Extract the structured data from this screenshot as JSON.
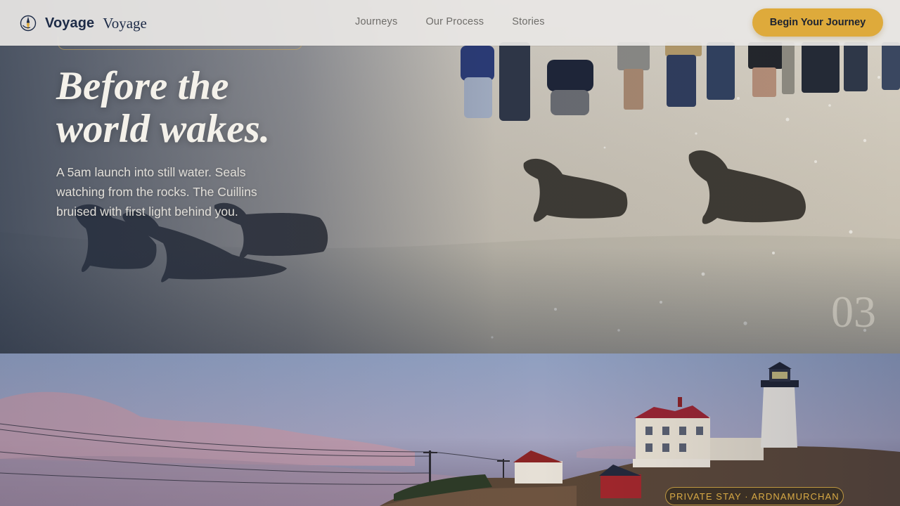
{
  "header": {
    "logo_icon": "compass-rose-icon",
    "brand_name": "Voyage",
    "brand_sub": "Voyage",
    "nav": [
      {
        "label": "Journeys"
      },
      {
        "label": "Our Process"
      },
      {
        "label": "Stories"
      }
    ],
    "cta_label": "Begin Your Journey"
  },
  "hero": {
    "title_line1": "Before the",
    "title_line2": "world wakes.",
    "description": "A 5am launch into still water. Seals watching from the rocks. The Cuillins bruised with first light behind you.",
    "slide_number": "03",
    "image_subject": "sea lions crossing a sandy beach with people watching"
  },
  "panel2": {
    "tag": "PRIVATE STAY · ARDNAMURCHAN",
    "image_subject": "lighthouse and white house on a rocky headland at dusk"
  },
  "colors": {
    "accent": "#deaa3b",
    "brand": "#1d2b47",
    "header_bg": "#e8e6e4",
    "hero_text": "#f4f1ea"
  }
}
